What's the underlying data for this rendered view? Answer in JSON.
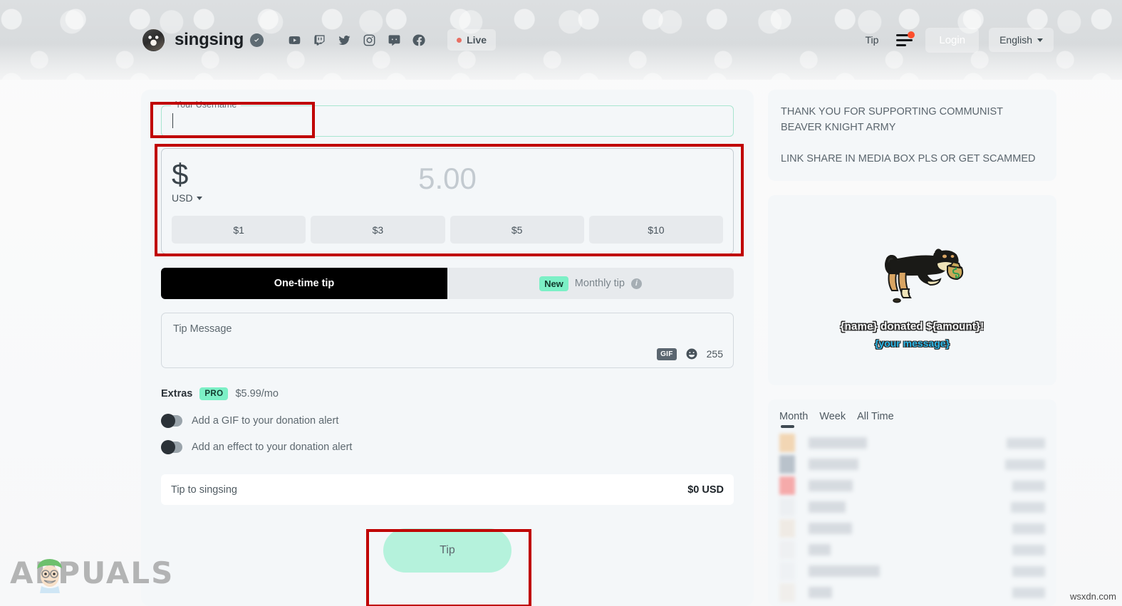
{
  "header": {
    "channel_name": "singsing",
    "verified_icon": "verified-check-icon",
    "socials": [
      {
        "name": "youtube-icon",
        "label": "YouTube"
      },
      {
        "name": "twitch-icon",
        "label": "Twitch"
      },
      {
        "name": "twitter-icon",
        "label": "Twitter"
      },
      {
        "name": "instagram-icon",
        "label": "Instagram"
      },
      {
        "name": "discord-icon",
        "label": "Discord"
      },
      {
        "name": "facebook-icon",
        "label": "Facebook"
      }
    ],
    "live_label": "Live",
    "tip_link": "Tip",
    "login_label": "Login",
    "language_label": "English",
    "menu_icon": "hamburger-menu-icon",
    "has_notification": true
  },
  "tip_form": {
    "username": {
      "label": "Your Username",
      "value": "",
      "placeholder": ""
    },
    "amount": {
      "currency_symbol": "$",
      "currency_code": "USD",
      "placeholder": "5.00",
      "value": "",
      "quick_amounts": [
        "$1",
        "$3",
        "$5",
        "$10"
      ]
    },
    "tabs": [
      {
        "label": "One-time tip",
        "active": true,
        "badge": ""
      },
      {
        "label": "Monthly tip",
        "active": false,
        "badge": "New"
      }
    ],
    "message": {
      "placeholder": "Tip Message",
      "value": "",
      "gif_label": "GIF",
      "emoji_icon": "emoji-smiley-icon",
      "char_remaining": "255"
    },
    "extras": {
      "title": "Extras",
      "badge": "PRO",
      "price": "$5.99/mo",
      "options": [
        {
          "label": "Add a GIF to your donation alert",
          "enabled": false
        },
        {
          "label": "Add an effect to your donation alert",
          "enabled": false
        }
      ]
    },
    "total": {
      "label": "Tip to singsing",
      "value": "$0 USD"
    },
    "submit_label": "Tip"
  },
  "sidebar": {
    "notice": [
      "THANK YOU FOR SUPPORTING COMMUNIST BEAVER KNIGHT ARMY",
      "LINK SHARE IN MEDIA BOX PLS OR GET SCAMMED"
    ],
    "alert_preview": {
      "image": "dog-with-money-bag-illustration",
      "name_line": "{name} donated ${amount}!",
      "message_line": "{your message}"
    },
    "leaderboard": {
      "tabs": [
        {
          "label": "Month",
          "active": true
        },
        {
          "label": "Week",
          "active": false
        },
        {
          "label": "All Time",
          "active": false
        }
      ],
      "rows": [
        {
          "avatar_color": "#f2d6b4",
          "name_width": 82,
          "amount_width": 54
        },
        {
          "avatar_color": "#b9c2cb",
          "name_width": 70,
          "amount_width": 56
        },
        {
          "avatar_color": "#f5aaaa",
          "name_width": 62,
          "amount_width": 46
        },
        {
          "avatar_color": "#eceff2",
          "name_width": 52,
          "amount_width": 48
        },
        {
          "avatar_color": "#efeae4",
          "name_width": 61,
          "amount_width": 46
        },
        {
          "avatar_color": "#eef0f2",
          "name_width": 31,
          "amount_width": 46
        },
        {
          "avatar_color": "#eef1f4",
          "name_width": 100,
          "amount_width": 46
        },
        {
          "avatar_color": "#f0eeeb",
          "name_width": 33,
          "amount_width": 46
        }
      ]
    }
  },
  "watermarks": {
    "brand": "PPUALS",
    "brand_initial": "A",
    "source": "wsxdn.com"
  },
  "colors": {
    "accent_mint": "#7cf0c6",
    "button_mint": "#b5f2dc",
    "card_bg": "#f4f7f9",
    "active_tab": "#000000",
    "live_dot": "#e96f63",
    "notification": "#fc4e2c"
  }
}
